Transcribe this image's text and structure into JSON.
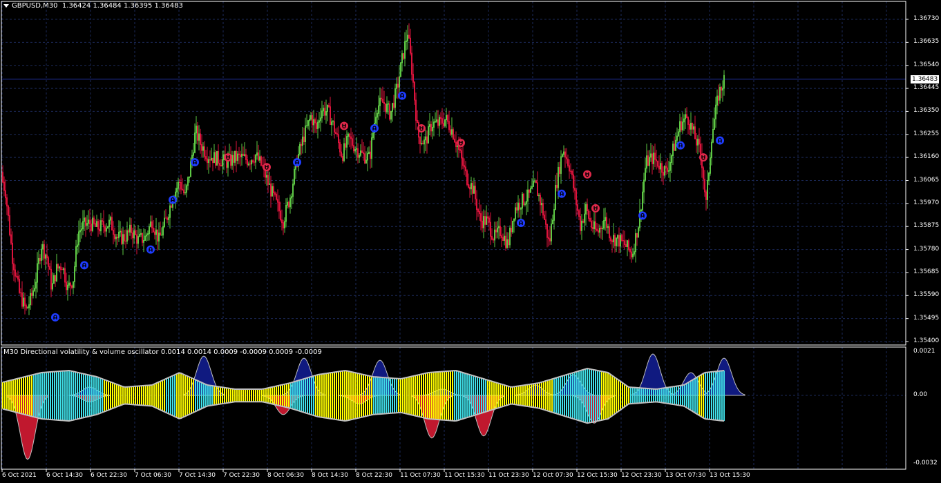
{
  "header": {
    "symbol": "GBPUSD,M30",
    "ohlc": "1.36424 1.36484 1.36395 1.36483"
  },
  "indicator": {
    "title": "M30 Directional volatility & volume oscillator 0.0014 0.0014 0.0009 -0.0009 0.0009 -0.0009"
  },
  "price_axis": {
    "ticks": [
      "1.36730",
      "1.36635",
      "1.36540",
      "1.36445",
      "1.36350",
      "1.36255",
      "1.36160",
      "1.36065",
      "1.35970",
      "1.35875",
      "1.35780",
      "1.35685",
      "1.35590",
      "1.35495",
      "1.35400"
    ],
    "current_price": "1.36483"
  },
  "indicator_axis": {
    "ticks": [
      "0.0021",
      "0.00",
      "-0.0032"
    ]
  },
  "time_axis": {
    "ticks": [
      "6 Oct 2021",
      "6 Oct 14:30",
      "6 Oct 22:30",
      "7 Oct 06:30",
      "7 Oct 14:30",
      "7 Oct 22:30",
      "8 Oct 06:30",
      "8 Oct 14:30",
      "8 Oct 22:30",
      "11 Oct 07:30",
      "11 Oct 15:30",
      "11 Oct 23:30",
      "12 Oct 07:30",
      "12 Oct 15:30",
      "12 Oct 23:30",
      "13 Oct 07:30",
      "13 Oct 15:30"
    ]
  },
  "colors": {
    "background": "#000000",
    "grid": "#1c2a5a",
    "bull": "#5ec845",
    "bear": "#dc143c",
    "up_arrow": "#1e3cff",
    "down_arrow": "#e0284a",
    "osc_cyan": "#40e0e8",
    "osc_yellow": "#ffff00",
    "osc_outline": "#c0c0c0",
    "osc_navy": "#101a80",
    "osc_red": "#c0182e",
    "price_line": "#2030a0"
  },
  "chart_data": {
    "type": "candlestick",
    "symbol": "GBPUSD",
    "timeframe": "M30",
    "ylim": [
      1.354,
      1.3673
    ],
    "close_path": [
      [
        0,
        1.361
      ],
      [
        8,
        1.3602
      ],
      [
        18,
        1.3575
      ],
      [
        28,
        1.356
      ],
      [
        38,
        1.3553
      ],
      [
        45,
        1.3558
      ],
      [
        52,
        1.3566
      ],
      [
        60,
        1.358
      ],
      [
        68,
        1.3575
      ],
      [
        75,
        1.3562
      ],
      [
        82,
        1.357
      ],
      [
        90,
        1.3572
      ],
      [
        98,
        1.3562
      ],
      [
        106,
        1.3566
      ],
      [
        113,
        1.3585
      ],
      [
        120,
        1.3588
      ],
      [
        130,
        1.3589
      ],
      [
        140,
        1.3587
      ],
      [
        150,
        1.3588
      ],
      [
        160,
        1.3589
      ],
      [
        170,
        1.3583
      ],
      [
        180,
        1.3583
      ],
      [
        190,
        1.3586
      ],
      [
        200,
        1.3582
      ],
      [
        210,
        1.3583
      ],
      [
        220,
        1.359
      ],
      [
        230,
        1.3582
      ],
      [
        240,
        1.359
      ],
      [
        250,
        1.36
      ],
      [
        260,
        1.3606
      ],
      [
        268,
        1.36
      ],
      [
        275,
        1.3611
      ],
      [
        283,
        1.3627
      ],
      [
        290,
        1.3622
      ],
      [
        300,
        1.3617
      ],
      [
        310,
        1.3616
      ],
      [
        320,
        1.3615
      ],
      [
        330,
        1.3614
      ],
      [
        340,
        1.3616
      ],
      [
        350,
        1.3616
      ],
      [
        360,
        1.3615
      ],
      [
        370,
        1.3617
      ],
      [
        380,
        1.3612
      ],
      [
        390,
        1.3604
      ],
      [
        400,
        1.3597
      ],
      [
        410,
        1.359
      ],
      [
        420,
        1.36
      ],
      [
        430,
        1.3615
      ],
      [
        440,
        1.3625
      ],
      [
        450,
        1.3633
      ],
      [
        458,
        1.3628
      ],
      [
        465,
        1.3636
      ],
      [
        475,
        1.3635
      ],
      [
        485,
        1.3627
      ],
      [
        495,
        1.3617
      ],
      [
        505,
        1.3624
      ],
      [
        515,
        1.362
      ],
      [
        525,
        1.3617
      ],
      [
        535,
        1.3616
      ],
      [
        545,
        1.3637
      ],
      [
        555,
        1.3639
      ],
      [
        565,
        1.3634
      ],
      [
        575,
        1.3645
      ],
      [
        583,
        1.3658
      ],
      [
        590,
        1.3668
      ],
      [
        597,
        1.365
      ],
      [
        605,
        1.3625
      ],
      [
        615,
        1.3622
      ],
      [
        625,
        1.363
      ],
      [
        635,
        1.363
      ],
      [
        645,
        1.3632
      ],
      [
        655,
        1.3627
      ],
      [
        665,
        1.3618
      ],
      [
        675,
        1.3608
      ],
      [
        685,
        1.3603
      ],
      [
        695,
        1.359
      ],
      [
        705,
        1.359
      ],
      [
        715,
        1.3583
      ],
      [
        725,
        1.3586
      ],
      [
        735,
        1.358
      ],
      [
        745,
        1.3595
      ],
      [
        755,
        1.3598
      ],
      [
        765,
        1.36
      ],
      [
        775,
        1.3605
      ],
      [
        785,
        1.3595
      ],
      [
        795,
        1.358
      ],
      [
        805,
        1.3605
      ],
      [
        815,
        1.362
      ],
      [
        825,
        1.3612
      ],
      [
        833,
        1.3599
      ],
      [
        840,
        1.3588
      ],
      [
        848,
        1.3595
      ],
      [
        856,
        1.3588
      ],
      [
        865,
        1.3585
      ],
      [
        875,
        1.3591
      ],
      [
        885,
        1.3583
      ],
      [
        895,
        1.3582
      ],
      [
        905,
        1.358
      ],
      [
        915,
        1.3576
      ],
      [
        925,
        1.359
      ],
      [
        935,
        1.3614
      ],
      [
        945,
        1.3616
      ],
      [
        955,
        1.3613
      ],
      [
        965,
        1.361
      ],
      [
        975,
        1.362
      ],
      [
        985,
        1.363
      ],
      [
        995,
        1.3633
      ],
      [
        1005,
        1.3625
      ],
      [
        1015,
        1.3617
      ],
      [
        1022,
        1.3597
      ],
      [
        1030,
        1.3625
      ],
      [
        1040,
        1.3642
      ],
      [
        1048,
        1.3648
      ]
    ],
    "signals": {
      "up_arrows": [
        [
          80,
          1.355
        ],
        [
          122,
          1.35715
        ],
        [
          218,
          1.3578
        ],
        [
          250,
          1.35985
        ],
        [
          282,
          1.3614
        ],
        [
          430,
          1.3614
        ],
        [
          542,
          1.3628
        ],
        [
          582,
          1.36415
        ],
        [
          754,
          1.3589
        ],
        [
          813,
          1.3601
        ],
        [
          930,
          1.3592
        ],
        [
          985,
          1.3621
        ],
        [
          1042,
          1.3623
        ]
      ],
      "down_arrows": [
        [
          498,
          1.3629
        ],
        [
          330,
          1.3616
        ],
        [
          386,
          1.3612
        ],
        [
          610,
          1.3628
        ],
        [
          667,
          1.3622
        ],
        [
          850,
          1.3609
        ],
        [
          862,
          1.3595
        ],
        [
          1018,
          1.3616
        ]
      ]
    },
    "oscillator": {
      "ylim": [
        -0.0032,
        0.0021
      ],
      "zero": 0.0
    }
  }
}
